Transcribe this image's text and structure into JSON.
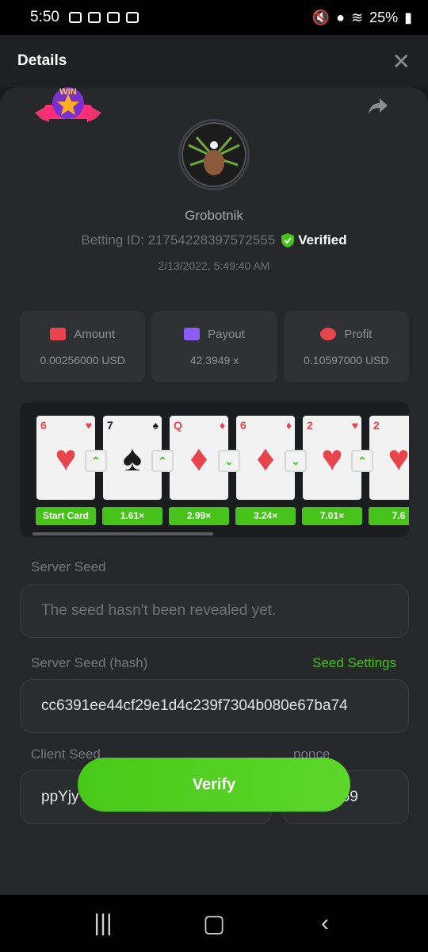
{
  "status": {
    "time": "5:50",
    "battery": "25%"
  },
  "header": {
    "title": "Details",
    "close_glyph": "✕"
  },
  "profile": {
    "username": "Grobotnik",
    "betting_id": "Betting ID: 21754228397572555",
    "verified_label": "Verified",
    "datetime": "2/13/2022, 5:49:40 AM"
  },
  "win_badge": {
    "text": "WIN"
  },
  "stats": {
    "amount": {
      "label": "Amount",
      "value": "0.00256000 USD",
      "icon_color": "#e8444b"
    },
    "payout": {
      "label": "Payout",
      "value": "42.3949 x",
      "icon_color": "#8b5cf6"
    },
    "profit": {
      "label": "Profit",
      "value": "0.10597000 USD",
      "icon_color": "#e8444b"
    }
  },
  "cards": [
    {
      "rank": "6",
      "suit": "♥",
      "color": "red",
      "multiplier": "Start Card",
      "arrow": ""
    },
    {
      "rank": "7",
      "suit": "♠",
      "color": "blk",
      "multiplier": "1.61×",
      "arrow": "up"
    },
    {
      "rank": "Q",
      "suit": "♦",
      "color": "red",
      "multiplier": "2.99×",
      "arrow": "up"
    },
    {
      "rank": "6",
      "suit": "♦",
      "color": "red",
      "multiplier": "3.24×",
      "arrow": "down"
    },
    {
      "rank": "2",
      "suit": "♥",
      "color": "red",
      "multiplier": "7.01×",
      "arrow": "down"
    },
    {
      "rank": "2",
      "suit": "♥",
      "color": "red",
      "multiplier": "7.6",
      "arrow": "up"
    }
  ],
  "server_seed": {
    "label": "Server Seed",
    "placeholder": "The seed hasn't been revealed yet."
  },
  "server_seed_hash": {
    "label": "Server Seed (hash)",
    "link": "Seed Settings",
    "value": "cc6391ee44cf29e1d4c239f7304b080e67ba74"
  },
  "client_seed": {
    "label": "Client Seed",
    "value": "ppYjyT1RdcsiB1CdG"
  },
  "nonce": {
    "label": "nonce",
    "value": "459"
  },
  "verify_label": "Verify",
  "colors": {
    "accent": "#47c21a",
    "background": "#18191c",
    "panel": "#26272b"
  }
}
